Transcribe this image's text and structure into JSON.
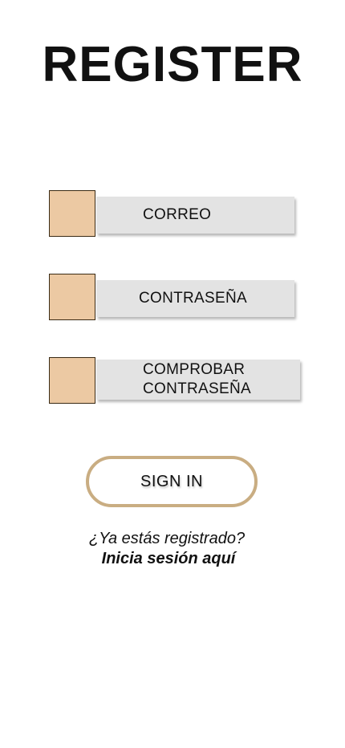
{
  "page": {
    "title": "REGISTER"
  },
  "form": {
    "fields": [
      {
        "label": "CORREO",
        "icon": "square-icon",
        "icon_color": "#ecc9a3"
      },
      {
        "label": "CONTRASEÑA",
        "icon": "square-icon",
        "icon_color": "#ecc9a3"
      },
      {
        "label": "COMPROBAR\nCONTRASEÑA",
        "icon": "square-icon",
        "icon_color": "#ecc9a3"
      }
    ],
    "submit_label": "SIGN IN",
    "submit_border_color": "#c9ad82"
  },
  "footer": {
    "question": "¿Ya estás registrado?",
    "link_label": "Inicia sesión aquí"
  }
}
